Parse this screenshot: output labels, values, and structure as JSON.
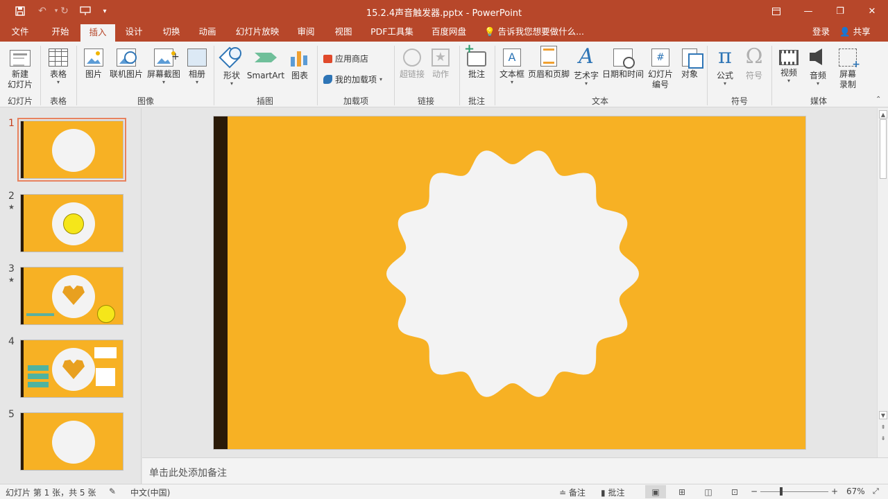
{
  "window": {
    "title": "15.2.4声音触发器.pptx - PowerPoint",
    "qat": {
      "save_icon": "save-icon",
      "undo_icon": "undo-icon",
      "redo_icon": "redo-icon",
      "present_icon": "present-icon",
      "customize_icon": "customize-qat-icon"
    },
    "controls": {
      "ribbon_display": "ribbon-display-icon",
      "minimize": "—",
      "restore": "❐",
      "close": "✕"
    }
  },
  "tabs": [
    {
      "label": "文件"
    },
    {
      "label": "开始"
    },
    {
      "label": "插入"
    },
    {
      "label": "设计"
    },
    {
      "label": "切换"
    },
    {
      "label": "动画"
    },
    {
      "label": "幻灯片放映"
    },
    {
      "label": "审阅"
    },
    {
      "label": "视图"
    },
    {
      "label": "PDF工具集"
    },
    {
      "label": "百度网盘"
    }
  ],
  "tell_me": "告诉我您想要做什么...",
  "signin": "登录",
  "share": "共享",
  "ribbon": {
    "new_slide": "新建\n幻灯片",
    "table": "表格",
    "picture": "图片",
    "online_picture": "联机图片",
    "screenshot": "屏幕截图",
    "album": "相册",
    "shapes": "形状",
    "smartart": "SmartArt",
    "chart": "图表",
    "store": "应用商店",
    "my_addins": "我的加载项",
    "hyperlink": "超链接",
    "action": "动作",
    "comment": "批注",
    "textbox": "文本框",
    "header_footer": "页眉和页脚",
    "wordart": "艺术字",
    "datetime": "日期和时间",
    "slide_number": "幻灯片\n编号",
    "object": "对象",
    "equation": "公式",
    "symbol": "符号",
    "video": "视频",
    "audio": "音频",
    "screen_record": "屏幕\n录制",
    "groups": {
      "slides": "幻灯片",
      "tables": "表格",
      "images": "图像",
      "illustrations": "插图",
      "addins": "加载项",
      "links": "链接",
      "comments": "批注",
      "text": "文本",
      "symbols": "符号",
      "media": "媒体"
    }
  },
  "thumbnails": [
    {
      "num": "1"
    },
    {
      "num": "2",
      "star": "★"
    },
    {
      "num": "3",
      "star": "★"
    },
    {
      "num": "4"
    },
    {
      "num": "5"
    }
  ],
  "notes_placeholder": "单击此处添加备注",
  "status": {
    "slide_info": "幻灯片 第 1 张，共 5 张",
    "language": "中文(中国)",
    "notes": "备注",
    "comments": "批注",
    "zoom": "67%"
  },
  "colors": {
    "accent": "#b7472a",
    "slide_bg": "#f7b124",
    "slide_bar": "#2a1a08",
    "blob": "#f3f3f3"
  }
}
